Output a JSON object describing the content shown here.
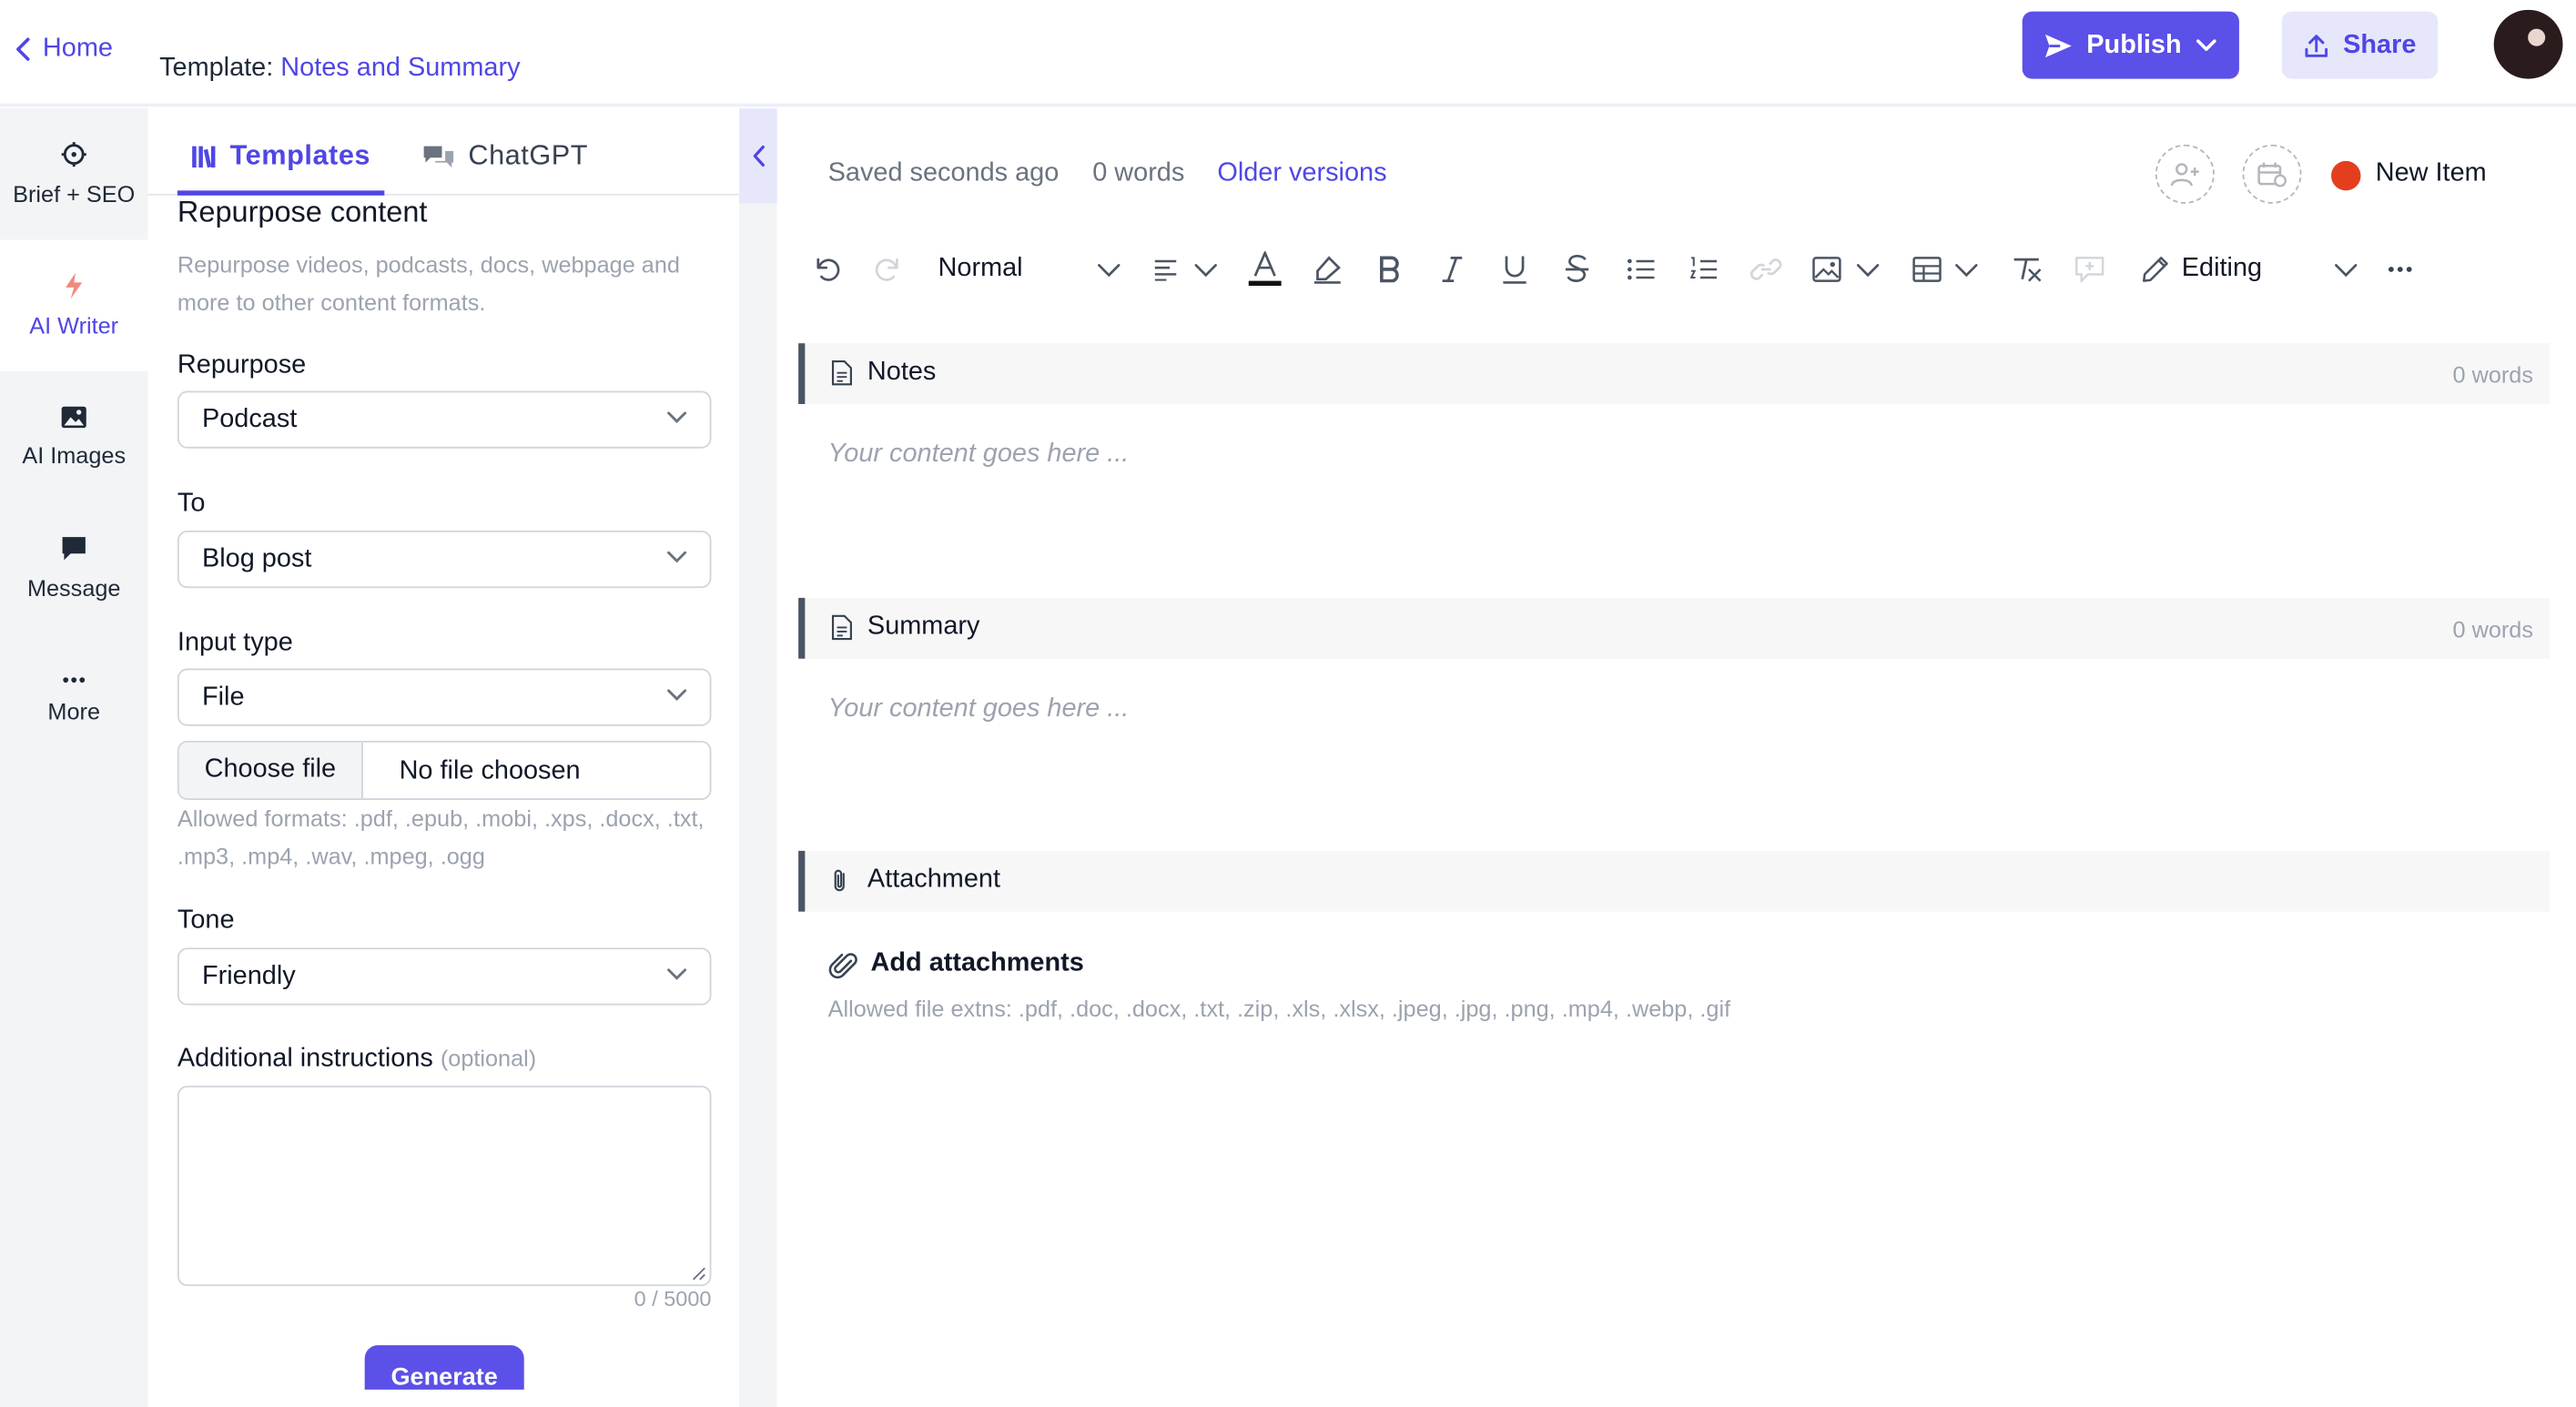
{
  "header": {
    "home_label": "Home",
    "template_prefix": "Template:",
    "template_name": "Notes and Summary",
    "publish_label": "Publish",
    "share_label": "Share"
  },
  "rail": {
    "items": [
      {
        "label": "Brief + SEO",
        "icon": "crosshair-icon"
      },
      {
        "label": "AI Writer",
        "icon": "lightning-icon"
      },
      {
        "label": "AI Images",
        "icon": "image-icon"
      },
      {
        "label": "Message",
        "icon": "chat-bubble-icon"
      },
      {
        "label": "More",
        "icon": "ellipsis-icon"
      }
    ]
  },
  "panel": {
    "tabs": [
      {
        "label": "Templates",
        "icon": "library-icon",
        "active": true
      },
      {
        "label": "ChatGPT",
        "icon": "chat-icon",
        "active": false
      }
    ],
    "title": "Repurpose content",
    "description": "Repurpose videos, podcasts, docs, webpage and more to other content formats.",
    "fields": {
      "repurpose_label": "Repurpose",
      "repurpose_value": "Podcast",
      "to_label": "To",
      "to_value": "Blog post",
      "input_type_label": "Input type",
      "input_type_value": "File",
      "choose_file_label": "Choose file",
      "file_name": "No file choosen",
      "file_hint": "Allowed formats: .pdf, .epub, .mobi, .xps, .docx, .txt, .mp3, .mp4, .wav, .mpeg, .ogg",
      "tone_label": "Tone",
      "tone_value": "Friendly",
      "instructions_label": "Additional instructions",
      "instructions_optional": "(optional)",
      "instructions_count": "0 / 5000"
    },
    "generate_label": "Generate"
  },
  "editor": {
    "saved_text": "Saved seconds ago",
    "word_count": "0 words",
    "older_versions": "Older versions",
    "status_label": "New Item",
    "status_color": "#e53e1f",
    "toolbar": {
      "style_value": "Normal",
      "mode_value": "Editing"
    },
    "sections": [
      {
        "title": "Notes",
        "words": "0 words",
        "placeholder": "Your content goes here ..."
      },
      {
        "title": "Summary",
        "words": "0 words",
        "placeholder": "Your content goes here ..."
      },
      {
        "title": "Attachment"
      }
    ],
    "attachments": {
      "add_label": "Add attachments",
      "hint": "Allowed file extns: .pdf, .doc, .docx, .txt, .zip, .xls, .xlsx, .jpeg, .jpg, .png, .mp4, .webp, .gif"
    }
  },
  "colors": {
    "accent": "#4f46e5",
    "button": "#5b50e8",
    "share_bg": "#e6e7fb"
  }
}
